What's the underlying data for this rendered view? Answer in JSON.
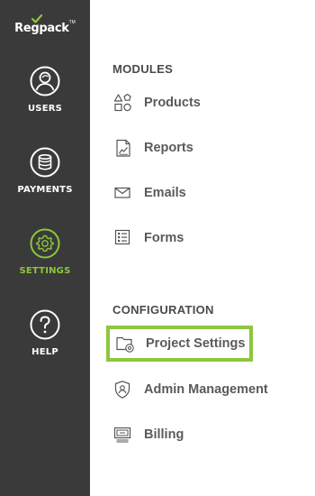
{
  "brand": {
    "logo_text": "Regpack",
    "trademark": "TM",
    "accent_color": "#8dc63f",
    "rail_color": "#3a3a3a"
  },
  "rail": {
    "items": [
      {
        "label": "USERS",
        "icon": "user-icon",
        "active": false
      },
      {
        "label": "PAYMENTS",
        "icon": "coins-icon",
        "active": false
      },
      {
        "label": "SETTINGS",
        "icon": "gear-icon",
        "active": true
      },
      {
        "label": "HELP",
        "icon": "help-icon",
        "active": false
      }
    ]
  },
  "menu": {
    "modules_title": "MODULES",
    "modules": [
      {
        "label": "Products",
        "icon": "shapes-icon"
      },
      {
        "label": "Reports",
        "icon": "report-icon"
      },
      {
        "label": "Emails",
        "icon": "envelope-icon"
      },
      {
        "label": "Forms",
        "icon": "form-icon"
      }
    ],
    "configuration_title": "CONFIGURATION",
    "configuration": [
      {
        "label": "Project Settings",
        "icon": "folder-settings-icon",
        "selected": true
      },
      {
        "label": "Admin Management",
        "icon": "shield-icon",
        "selected": false
      },
      {
        "label": "Billing",
        "icon": "billing-icon",
        "selected": false
      }
    ]
  }
}
